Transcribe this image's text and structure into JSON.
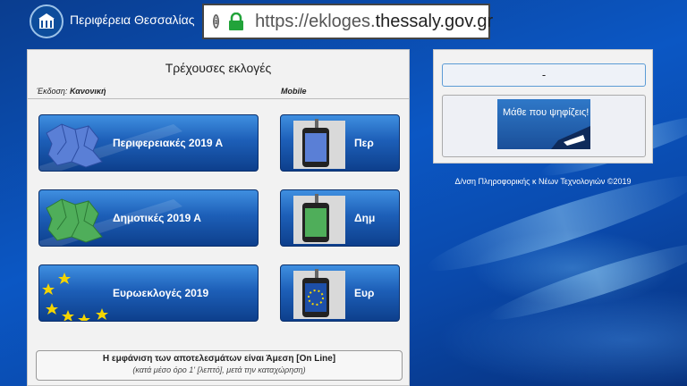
{
  "header": {
    "region_name": "Περιφέρεια Θεσσαλίας",
    "url_prefix": "https://ekloges.",
    "url_domain": "thessaly.gov.gr"
  },
  "panel": {
    "title": "Τρέχουσες εκλογές",
    "edition_label": "Έκδοση:",
    "edition_value": "Κανονική",
    "mobile_label": "Mobile",
    "elections": [
      {
        "label": "Περιφερειακές 2019 Α",
        "mobile_label": "Περ",
        "map": "thessaly-map-blue-icon"
      },
      {
        "label": "Δημοτικές 2019 Α",
        "mobile_label": "Δημ",
        "map": "thessaly-map-green-icon"
      },
      {
        "label": "Ευρωεκλογές 2019",
        "mobile_label": "Ευρ",
        "map": "eu-stars-icon"
      }
    ],
    "note_line1": "Η εμφάνιση των αποτελεσμάτων είναι Άμεση [On Line]",
    "note_line2": "(κατά μέσο όρο 1' [λεπτό], μετά την καταχώρηση)"
  },
  "right": {
    "dash_value": "-",
    "learn_text": "Μάθε που ψηφίζεις!"
  },
  "footer": "Δ/νση Πληροφορικής κ Νέων Τεχνολογιών ©2019",
  "colors": {
    "lock": "#22a33a",
    "eu_star": "#f5d500",
    "map_blue": "#5a7fd6",
    "map_green": "#4fae5a"
  }
}
